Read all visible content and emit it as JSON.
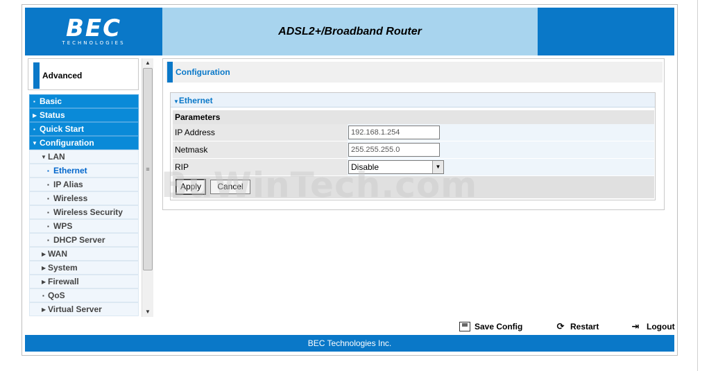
{
  "header": {
    "logo_main": "BEC",
    "logo_sub": "TECHNOLOGIES",
    "title": "ADSL2+/Broadband Router"
  },
  "sidebar": {
    "section_label": "Advanced",
    "items": [
      {
        "label": "Basic"
      },
      {
        "label": "Status"
      },
      {
        "label": "Quick Start"
      },
      {
        "label": "Configuration"
      },
      {
        "label": "LAN"
      },
      {
        "label": "Ethernet"
      },
      {
        "label": "IP Alias"
      },
      {
        "label": "Wireless"
      },
      {
        "label": "Wireless Security"
      },
      {
        "label": "WPS"
      },
      {
        "label": "DHCP Server"
      },
      {
        "label": "WAN"
      },
      {
        "label": "System"
      },
      {
        "label": "Firewall"
      },
      {
        "label": "QoS"
      },
      {
        "label": "Virtual Server"
      }
    ]
  },
  "main": {
    "section_title": "Configuration",
    "panel_title": "Ethernet",
    "params_header": "Parameters",
    "fields": {
      "ip_label": "IP Address",
      "ip_value": "192.168.1.254",
      "mask_label": "Netmask",
      "mask_value": "255.255.255.0",
      "rip_label": "RIP",
      "rip_value": "Disable"
    },
    "buttons": {
      "apply": "Apply",
      "cancel": "Cancel"
    }
  },
  "watermark": "BuWinTech.com",
  "actions": {
    "save": "Save Config",
    "restart": "Restart",
    "logout": "Logout"
  },
  "footer": {
    "text": "BEC Technologies Inc."
  },
  "colors": {
    "brand_blue": "#0a78c8",
    "header_light": "#a8d4ee"
  }
}
